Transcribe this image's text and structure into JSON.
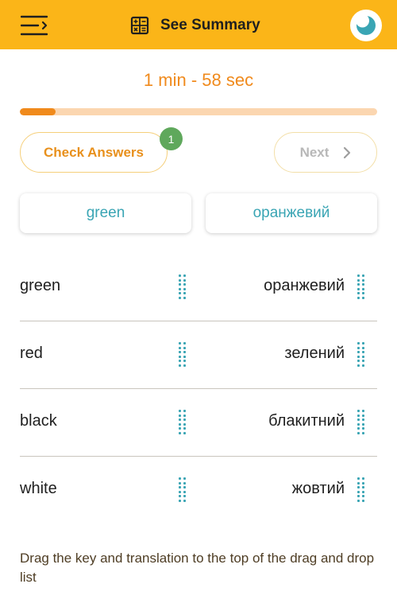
{
  "header": {
    "menu_icon": "menu-collapse-icon",
    "summary_icon": "calculator-icon",
    "summary_label": "See Summary",
    "theme_icon": "moon-icon",
    "background_color": "#fbb518"
  },
  "timer": {
    "text": "1 min - 58 sec",
    "color": "#f08a1c"
  },
  "progress": {
    "fraction": 0.1
  },
  "actions": {
    "check_label": "Check Answers",
    "check_badge": "1",
    "next_label": "Next",
    "next_icon": "chevron-right-icon"
  },
  "selected": {
    "key": "green",
    "translation": "оранжевий"
  },
  "pairs": [
    {
      "word": "green",
      "translation": "оранжевий"
    },
    {
      "word": "red",
      "translation": "зелений"
    },
    {
      "word": "black",
      "translation": "блакитний"
    },
    {
      "word": "white",
      "translation": "жовтий"
    }
  ],
  "instructions": "Drag the key and translation to the top of the drag and drop list",
  "colors": {
    "accent": "#f08a1c",
    "teal": "#3aa5b4",
    "badge": "#5fa85c"
  }
}
